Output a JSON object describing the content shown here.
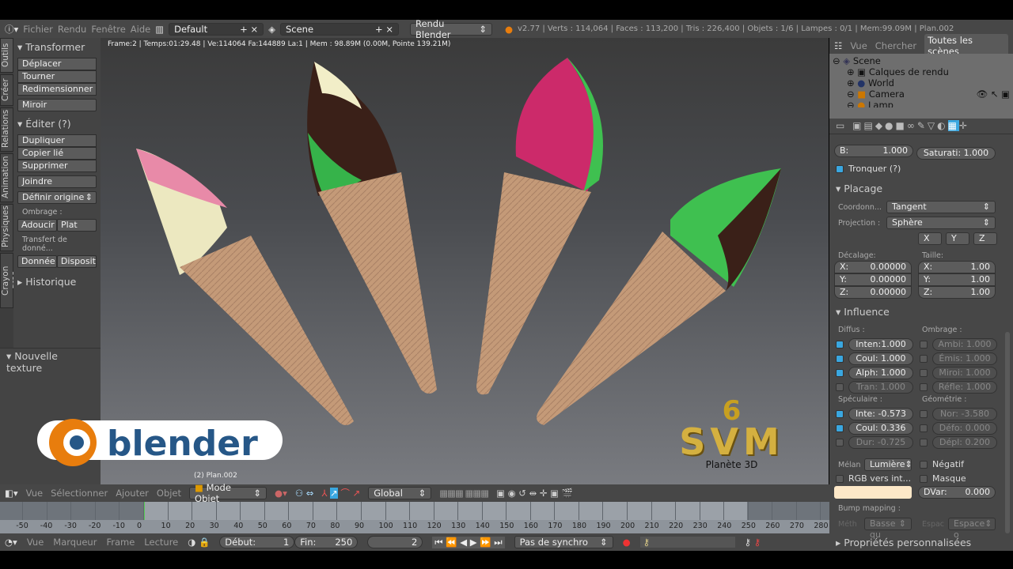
{
  "topbar": {
    "menus": [
      "Fichier",
      "Rendu",
      "Fenêtre",
      "Aide"
    ],
    "layout": "Default",
    "scene": "Scene",
    "engine": "Rendu Blender",
    "stats": "v2.77 | Verts : 114,064 | Faces : 113,200 | Tris : 226,400 | Objets : 1/6 | Lampes : 0/1 | Mem:99.09M | Plan.002"
  },
  "tabs": [
    "Outils",
    "Créer",
    "Relations",
    "Animation",
    "Physiques",
    "Crayon gras"
  ],
  "tools": {
    "transform_title": "Transformer",
    "transform": [
      "Déplacer",
      "Tourner",
      "Redimensionner"
    ],
    "mirror": "Miroir",
    "edit_title": "Éditer (?)",
    "edit": [
      "Dupliquer",
      "Copier lié",
      "Supprimer"
    ],
    "join": "Joindre",
    "set_origin": "Définir origine",
    "shading_label": "Ombrage :",
    "shading": [
      "Adoucir",
      "Plat"
    ],
    "transfer_label": "Transfert de donné...",
    "transfer": [
      "Donnée",
      "Disposit"
    ],
    "history": "Historique",
    "new_texture": "Nouvelle texture"
  },
  "viewport": {
    "info": "Frame:2 | Temps:01:29.48 | Ve:114064 Fa:144889 La:1 | Mem  : 98.89M (0.00M, Pointe 139.21M)",
    "object_name": "(2) Plan.002",
    "logo_text": "blender",
    "logo2_text": "SVM",
    "logo2_sub": "Planète 3D",
    "logo2_num": "6"
  },
  "outliner": {
    "tabs": [
      "Vue",
      "Chercher",
      "Toutes les scènes"
    ],
    "items": [
      "Scene",
      "Calques de rendu",
      "World",
      "Camera",
      "Lamp"
    ]
  },
  "props": {
    "b_label": "B:",
    "b_value": "1.000",
    "saturation": "Saturati: 1.000",
    "tronquer": "Tronquer (?)",
    "placage": "Placage",
    "coord_label": "Coordonn...",
    "coord_value": "Tangent",
    "proj_label": "Projection :",
    "proj_value": "Sphère",
    "axes": [
      "X",
      "Y",
      "Z"
    ],
    "offset_label": "Décalage:",
    "offset": [
      [
        "X:",
        "0.00000"
      ],
      [
        "Y:",
        "0.00000"
      ],
      [
        "Z:",
        "0.00000"
      ]
    ],
    "size_label": "Taille:",
    "size": [
      [
        "X:",
        "1.00"
      ],
      [
        "Y:",
        "1.00"
      ],
      [
        "Z:",
        "1.00"
      ]
    ],
    "influence": "Influence",
    "diffuse_label": "Diffus :",
    "diffuse": [
      {
        "t": "Inten:1.000",
        "on": true
      },
      {
        "t": "Coul: 1.000",
        "on": true
      },
      {
        "t": "Alph: 1.000",
        "on": true
      },
      {
        "t": "Tran: 1.000",
        "on": false
      }
    ],
    "shading_label": "Ombrage :",
    "shading": [
      {
        "t": "Ambi: 1.000",
        "on": false
      },
      {
        "t": "Émis: 1.000",
        "on": false
      },
      {
        "t": "Miroi: 1.000",
        "on": false
      },
      {
        "t": "Réfle: 1.000",
        "on": false
      }
    ],
    "spec_label": "Spéculaire :",
    "spec": [
      {
        "t": "Inte: -0.573",
        "on": true
      },
      {
        "t": "Coul: 0.336",
        "on": true
      },
      {
        "t": "Dur: -0.725",
        "on": false
      }
    ],
    "geom_label": "Géométrie :",
    "geom": [
      {
        "t": "Nor: -3.580",
        "on": false
      },
      {
        "t": "Défo: 0.000",
        "on": false
      },
      {
        "t": "Dépl: 0.200",
        "on": false
      }
    ],
    "blend_label": "Mélan",
    "blend_value": "Lumière",
    "negative": "Négatif",
    "rgb": "RGB vers int...",
    "mask": "Masque",
    "color": "#fde8c8",
    "dvar": "DVar:",
    "dvar_value": "0.000",
    "bump_label": "Bump mapping :",
    "meth": "Méth",
    "meth_value": "Basse qu",
    "space": "Espac",
    "space_value": "Espace o",
    "custom": "Propriétés personnalisées"
  },
  "view3d_header": {
    "menus": [
      "Vue",
      "Sélectionner",
      "Ajouter",
      "Objet"
    ],
    "mode": "Mode Objet",
    "orientation": "Global"
  },
  "timeline": {
    "ticks": [
      -50,
      -40,
      -30,
      -20,
      -10,
      0,
      10,
      20,
      30,
      40,
      50,
      60,
      70,
      80,
      90,
      100,
      110,
      120,
      130,
      140,
      150,
      160,
      170,
      180,
      190,
      200,
      210,
      220,
      230,
      240,
      250,
      260,
      270,
      280
    ],
    "current_frame": 2,
    "start": 250
  },
  "timeline_header": {
    "menus": [
      "Vue",
      "Marqueur",
      "Frame",
      "Lecture"
    ],
    "start_label": "Début:",
    "start": "1",
    "end_label": "Fin:",
    "end": "250",
    "current": "2",
    "sync": "Pas de synchro"
  }
}
